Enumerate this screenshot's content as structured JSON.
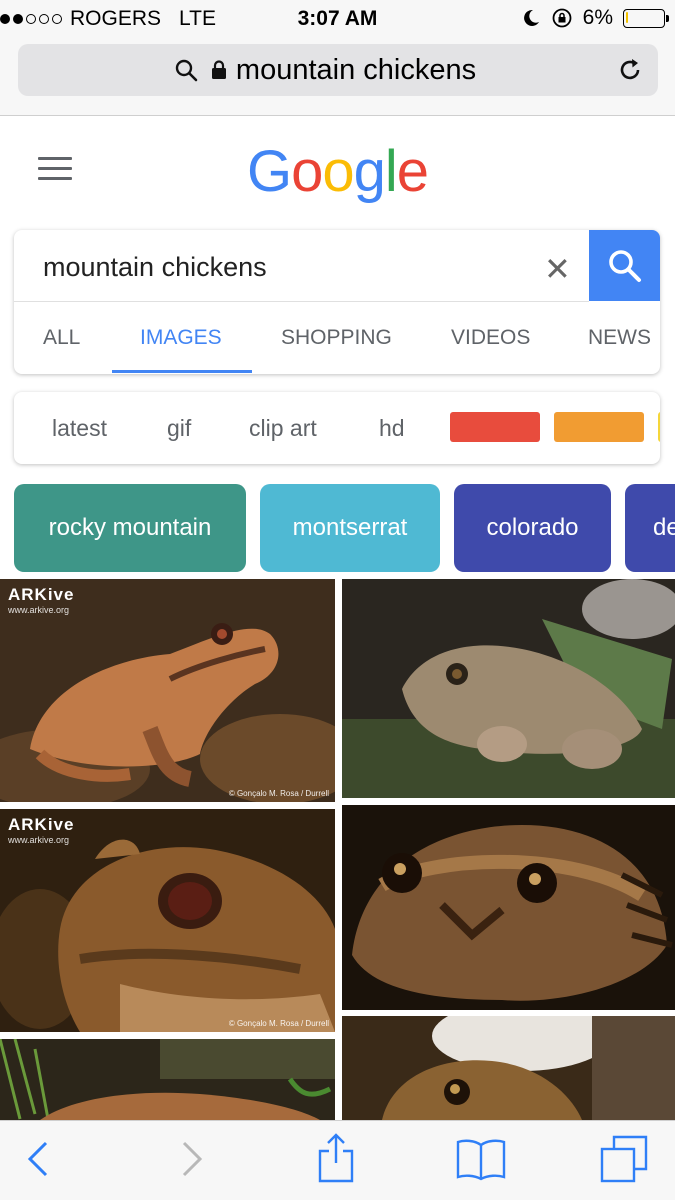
{
  "status": {
    "carrier": "ROGERS",
    "network": "LTE",
    "time": "3:07 AM",
    "battery": "6%",
    "battery_level": 0.06,
    "signal_bars": 2,
    "signal_total": 5,
    "icons": [
      "moon-icon",
      "rotation-lock-icon"
    ]
  },
  "url_bar": {
    "text": "mountain chickens",
    "icons": [
      "search-icon",
      "lock-icon",
      "reload-icon"
    ]
  },
  "google": {
    "logo_letters": [
      {
        "ch": "G",
        "color": "#4285f4"
      },
      {
        "ch": "o",
        "color": "#ea4335"
      },
      {
        "ch": "o",
        "color": "#fbbc05"
      },
      {
        "ch": "g",
        "color": "#4285f4"
      },
      {
        "ch": "l",
        "color": "#34a853"
      },
      {
        "ch": "e",
        "color": "#ea4335"
      }
    ]
  },
  "search": {
    "query": "mountain chickens",
    "clear_icon": "close-icon",
    "submit_icon": "search-icon",
    "accent": "#4285f4"
  },
  "tabs": [
    {
      "label": "ALL",
      "active": false
    },
    {
      "label": "IMAGES",
      "active": true
    },
    {
      "label": "SHOPPING",
      "active": false
    },
    {
      "label": "VIDEOS",
      "active": false
    },
    {
      "label": "NEWS",
      "active": false
    }
  ],
  "filters": {
    "words": [
      "latest",
      "gif",
      "clip art",
      "hd"
    ],
    "colors": [
      "#e84c3d",
      "#f19c32",
      "#f5d63a"
    ]
  },
  "chips": [
    {
      "label": "rocky mountain",
      "color": "#3e9688"
    },
    {
      "label": "montserrat",
      "color": "#4fb9d3"
    },
    {
      "label": "colorado",
      "color": "#3f4aab"
    },
    {
      "label": "de",
      "color": "#3f4aab"
    }
  ],
  "results": [
    {
      "watermark": "ARKive",
      "watermark_sub": "www.arkive.org",
      "credit": "© Gonçalo M. Rosa / Durrell"
    },
    {
      "watermark": "",
      "watermark_sub": "",
      "credit": ""
    },
    {
      "watermark": "ARKive",
      "watermark_sub": "www.arkive.org",
      "credit": "© Gonçalo M. Rosa / Durrell"
    },
    {
      "watermark": "",
      "watermark_sub": "",
      "credit": ""
    },
    {
      "watermark": "",
      "watermark_sub": "",
      "credit": ""
    },
    {
      "watermark": "",
      "watermark_sub": "",
      "credit": ""
    }
  ],
  "toolbar": {
    "icons": [
      "back-icon",
      "forward-icon",
      "share-icon",
      "bookmarks-icon",
      "tabs-icon"
    ],
    "tint": "#2f7ff7"
  }
}
